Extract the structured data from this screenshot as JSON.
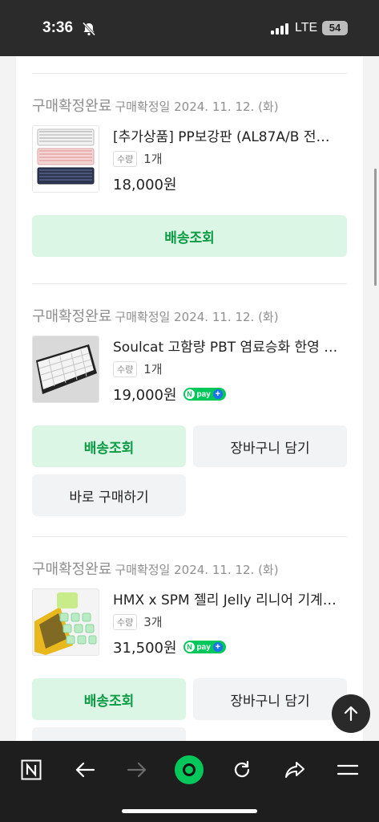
{
  "status_bar": {
    "time": "3:36",
    "network": "LTE",
    "battery": "54"
  },
  "orders": [
    {
      "status": "구매확정완료",
      "date": "구매확정일 2024. 11. 12. (화)",
      "product_name": "[추가상품] PP보강판 (AL87A/B 전…",
      "qty_label": "수량",
      "qty": "1개",
      "price": "18,000원",
      "npay": false,
      "buttons": [
        "배송조회"
      ]
    },
    {
      "status": "구매확정완료",
      "date": "구매확정일 2024. 11. 12. (화)",
      "product_name": "Soulcat 고함량 PBT 염료승화 한영 …",
      "qty_label": "수량",
      "qty": "1개",
      "price": "19,000원",
      "npay": true,
      "buttons": [
        "배송조회",
        "장바구니 담기",
        "바로 구매하기"
      ]
    },
    {
      "status": "구매확정완료",
      "date": "구매확정일 2024. 11. 12. (화)",
      "product_name": "HMX x SPM 젤리 Jelly 리니어 기계…",
      "qty_label": "수량",
      "qty": "3개",
      "price": "31,500원",
      "npay": true,
      "buttons": [
        "배송조회",
        "장바구니 담기"
      ]
    }
  ],
  "npay_label": {
    "n": "N",
    "text": "pay",
    "plus": "+"
  },
  "colors": {
    "green_text": "#0a9b43",
    "green_bg": "#dcf6e5",
    "npay": "#03c75a"
  },
  "bottom_nav": [
    "naver-icon",
    "back-icon",
    "forward-icon",
    "green-dot-icon",
    "refresh-icon",
    "share-icon",
    "menu-icon"
  ]
}
